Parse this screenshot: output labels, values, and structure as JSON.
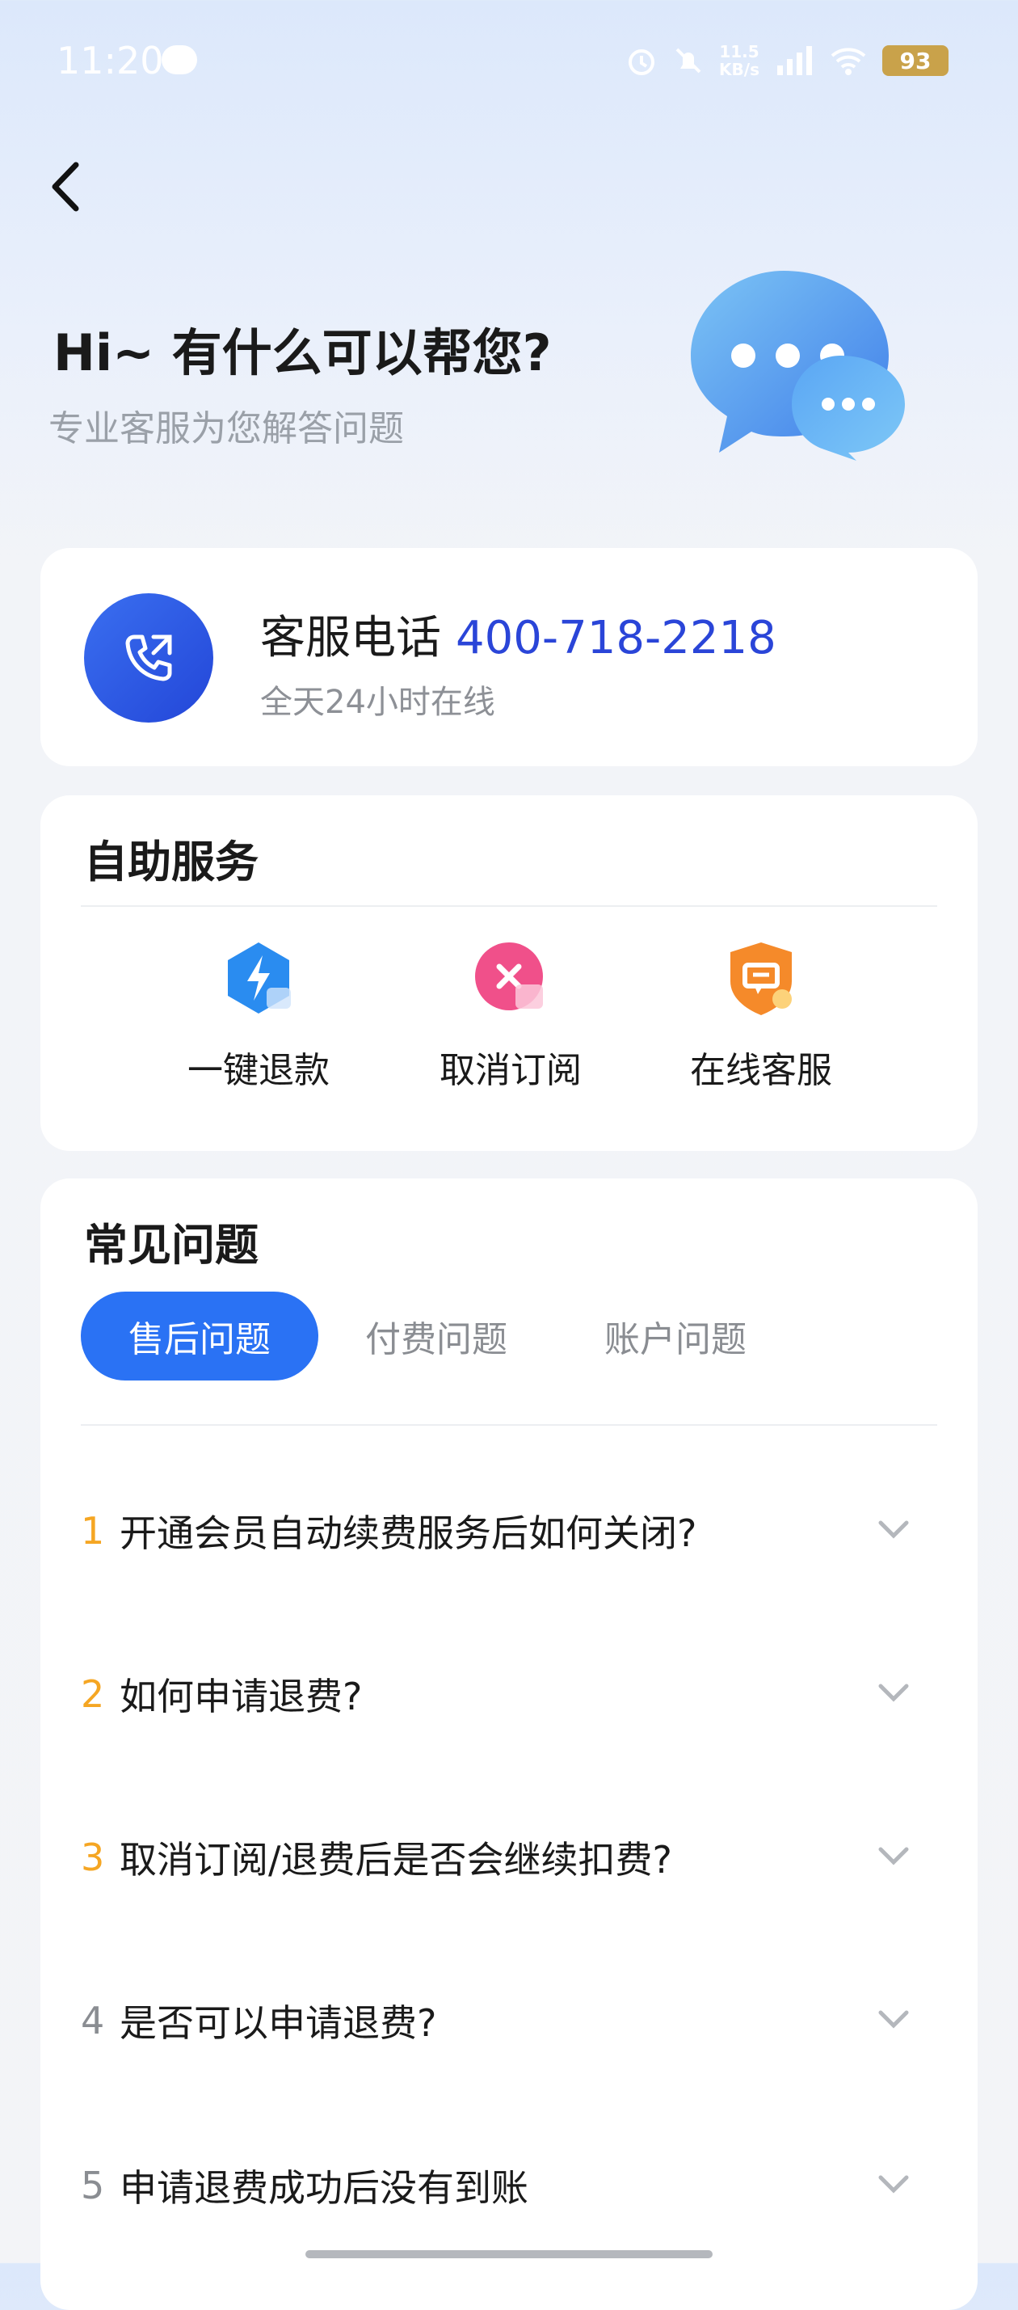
{
  "status": {
    "time": "11:20",
    "net_speed_value": "11.5",
    "net_speed_unit": "KB/s",
    "signal": "5G",
    "battery": "93"
  },
  "hero": {
    "title": "Hi~ 有什么可以帮您?",
    "subtitle": "专业客服为您解答问题"
  },
  "phone_card": {
    "label": "客服电话",
    "number": "400-718-2218",
    "sub": "全天24小时在线"
  },
  "self_service": {
    "title": "自助服务",
    "items": [
      {
        "label": "一键退款",
        "icon": "lightning-shield-icon",
        "color": "#2a8cf0"
      },
      {
        "label": "取消订阅",
        "icon": "cancel-circle-icon",
        "color": "#f0508a"
      },
      {
        "label": "在线客服",
        "icon": "chat-shield-icon",
        "color": "#f58a2a"
      }
    ]
  },
  "faq": {
    "title": "常见问题",
    "tabs": [
      "售后问题",
      "付费问题",
      "账户问题"
    ],
    "active_tab": 0,
    "items": [
      {
        "num": "1",
        "text": "开通会员自动续费服务后如何关闭?"
      },
      {
        "num": "2",
        "text": "如何申请退费?"
      },
      {
        "num": "3",
        "text": "取消订阅/退费后是否会继续扣费?"
      },
      {
        "num": "4",
        "text": "是否可以申请退费?"
      },
      {
        "num": "5",
        "text": "申请退费成功后没有到账"
      }
    ]
  },
  "colors": {
    "accent": "#2a72f4",
    "phone_number": "#2a45d8",
    "highlight_num": "#f5a623"
  }
}
